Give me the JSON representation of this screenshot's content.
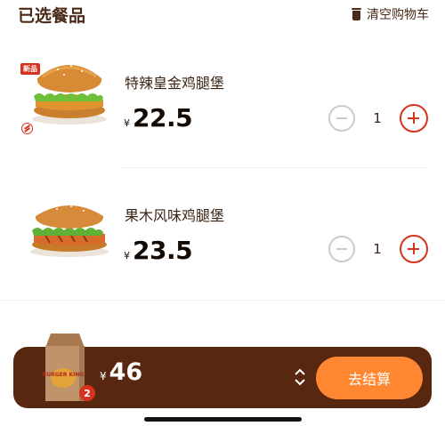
{
  "header": {
    "title": "已选餐品",
    "clear_label": "清空购物车"
  },
  "items": [
    {
      "name": "特辣皇金鸡腿堡",
      "currency": "¥",
      "price": "22.5",
      "quantity": "1",
      "badge": "新品"
    },
    {
      "name": "果木风味鸡腿堡",
      "currency": "¥",
      "price": "23.5",
      "quantity": "1"
    }
  ],
  "cart": {
    "currency": "¥",
    "total": "46",
    "count": "2",
    "checkout_label": "去结算",
    "bag_logo": "BURGER KING"
  },
  "colors": {
    "accent": "#d8321f",
    "brown": "#582710",
    "checkout": "#ff8732"
  }
}
